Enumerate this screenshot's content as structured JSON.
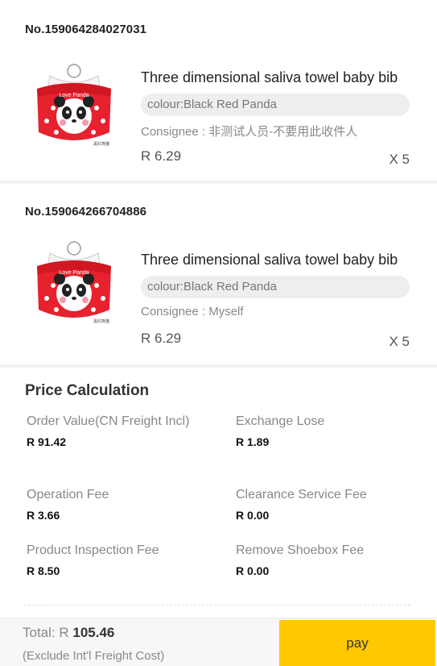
{
  "orders": [
    {
      "number": "No.159064284027031",
      "title": "Three dimensional saliva towel baby bib",
      "colour": "colour:Black Red Panda",
      "consignee": "Consignee : 非测试人员-不要用此收件人",
      "price": "R 6.29",
      "quantity": "X 5",
      "image_icon": "panda-bib-icon",
      "image_text": "Love Panda",
      "image_caption": "黑红熊猫"
    },
    {
      "number": "No.159064266704886",
      "title": "Three dimensional saliva towel baby bib",
      "colour": "colour:Black Red Panda",
      "consignee": "Consignee : Myself",
      "price": "R 6.29",
      "quantity": "X 5",
      "image_icon": "panda-bib-icon",
      "image_text": "Love Panda",
      "image_caption": "黑红熊猫"
    }
  ],
  "price_calculation": {
    "title": "Price Calculation",
    "items": [
      {
        "label": "Order Value(CN Freight Incl)",
        "value": "R 91.42"
      },
      {
        "label": "Exchange Lose",
        "value": "R 1.89"
      },
      {
        "label": "Operation Fee",
        "value": "R 3.66"
      },
      {
        "label": "Clearance Service Fee",
        "value": "R 0.00"
      },
      {
        "label": "Product Inspection Fee",
        "value": "R 8.50"
      },
      {
        "label": "Remove Shoebox Fee",
        "value": "R 0.00"
      }
    ]
  },
  "footer": {
    "total_label": "Total: R",
    "total_amount": "105.46",
    "note": "(Exclude Int'l Freight Cost)",
    "pay_label": "pay"
  },
  "colors": {
    "pay_button": "#ffc800",
    "bib_red": "#e8212e",
    "background": "#f2f2f2"
  }
}
